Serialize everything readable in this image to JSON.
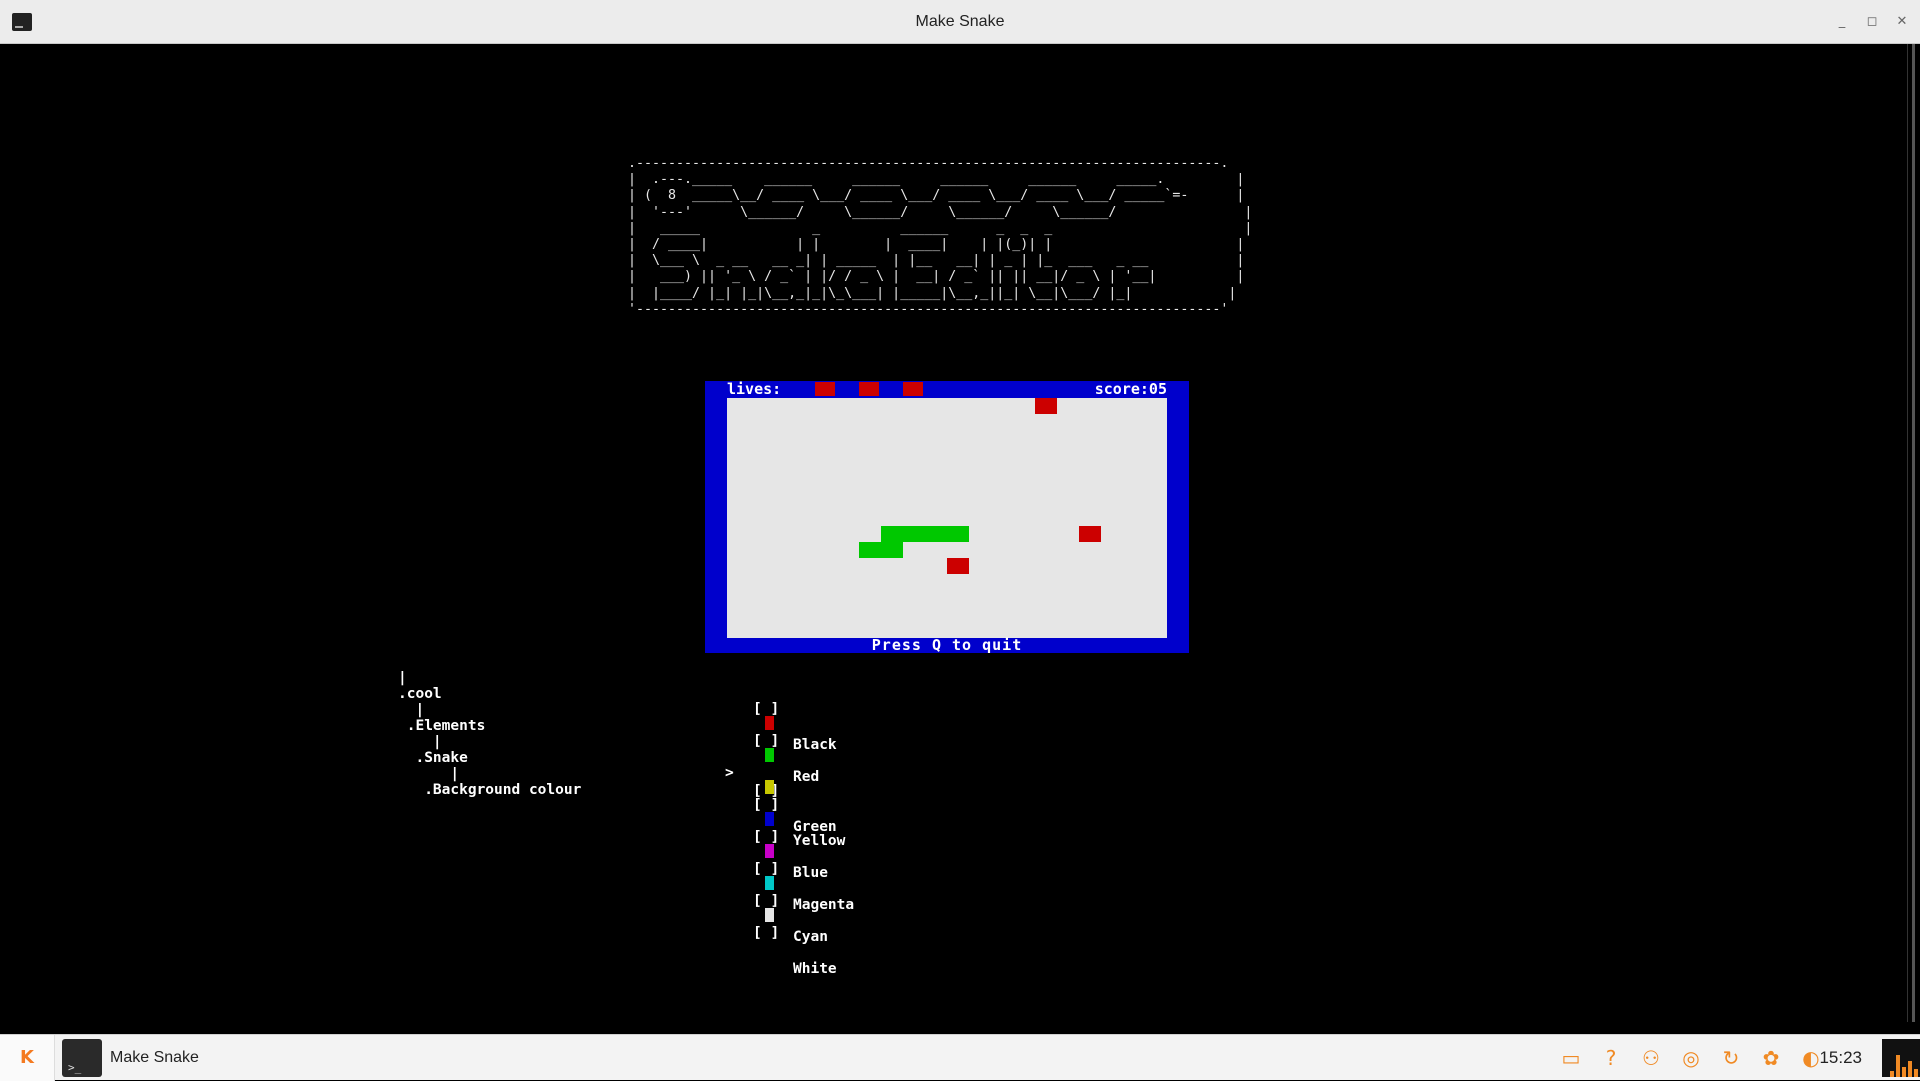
{
  "window": {
    "title": "Make Snake",
    "icon": "terminal-icon",
    "controls": [
      "minimize",
      "maximize",
      "close"
    ],
    "controls_glyphs": [
      "_",
      "◻",
      "✕"
    ]
  },
  "banner": {
    "ascii": " .-------------------------------------------------------------------------.\n |  .---._____    ______     ______     ______     ______     _____.         |\n | (  8  _____\\__/ ____ \\___/ ____ \\___/ ____ \\___/ ____ \\___/ _____`=-      |\n |  '---'      \\______/     \\______/     \\______/     \\______/                |\n |   _____              _          ______      _  _  _                        |\n |  / ____|           | |        |  ____|    | |(_)| |                       |\n |  \\___ \\  _ __   __ _| | _____  | |__   __| | _ | |_  ___   _ __           |\n |   ___) || '_ \\ / _` | |/ / _ \\ |  __| / _` || || __|/ _ \\ | '__|          |\n |  |____/ |_| |_|\\__,_|_|\\_\\___| |_____|\\__,_||_| \\__|\\___/ |_|            |\n '-------------------------------------------------------------------------'"
  },
  "game": {
    "lives_label": "lives:",
    "lives": 3,
    "score_label": "score:05",
    "quit_hint": "Press Q to quit",
    "colors": {
      "border": "#0000cc",
      "field": "#e6e6e6",
      "snake": "#00c800",
      "food": "#cc0000"
    }
  },
  "tree": {
    "lines": [
      "|",
      ".cool",
      "  |",
      " .Elements",
      "    |",
      "  .Snake",
      "      |",
      "   .Background colour"
    ]
  },
  "color_menu": {
    "selected_index": 2,
    "cursor_glyph": ">",
    "options": [
      {
        "label": "Black",
        "swatch": "#000000"
      },
      {
        "label": "Red",
        "swatch": "#cc0000"
      },
      {
        "label": "Green",
        "swatch": "#00c800"
      },
      {
        "label": "Yellow",
        "swatch": "#c8c800"
      },
      {
        "label": "Blue",
        "swatch": "#0000cc"
      },
      {
        "label": "Magenta",
        "swatch": "#c800c8"
      },
      {
        "label": "Cyan",
        "swatch": "#00c8c8"
      },
      {
        "label": "White",
        "swatch": "#e6e6e6"
      }
    ]
  },
  "taskbar": {
    "start_label": "K",
    "task_label": "Make Snake",
    "tray_icons": [
      "window-icon",
      "help-icon",
      "user-icon",
      "network-icon",
      "updates-icon",
      "settings-icon",
      "volume-icon"
    ],
    "tray_glyphs": [
      "▭",
      "?",
      "⚇",
      "◎",
      "↻",
      "✿",
      "◐"
    ],
    "clock": "15:23",
    "accent": "#f08a24"
  }
}
